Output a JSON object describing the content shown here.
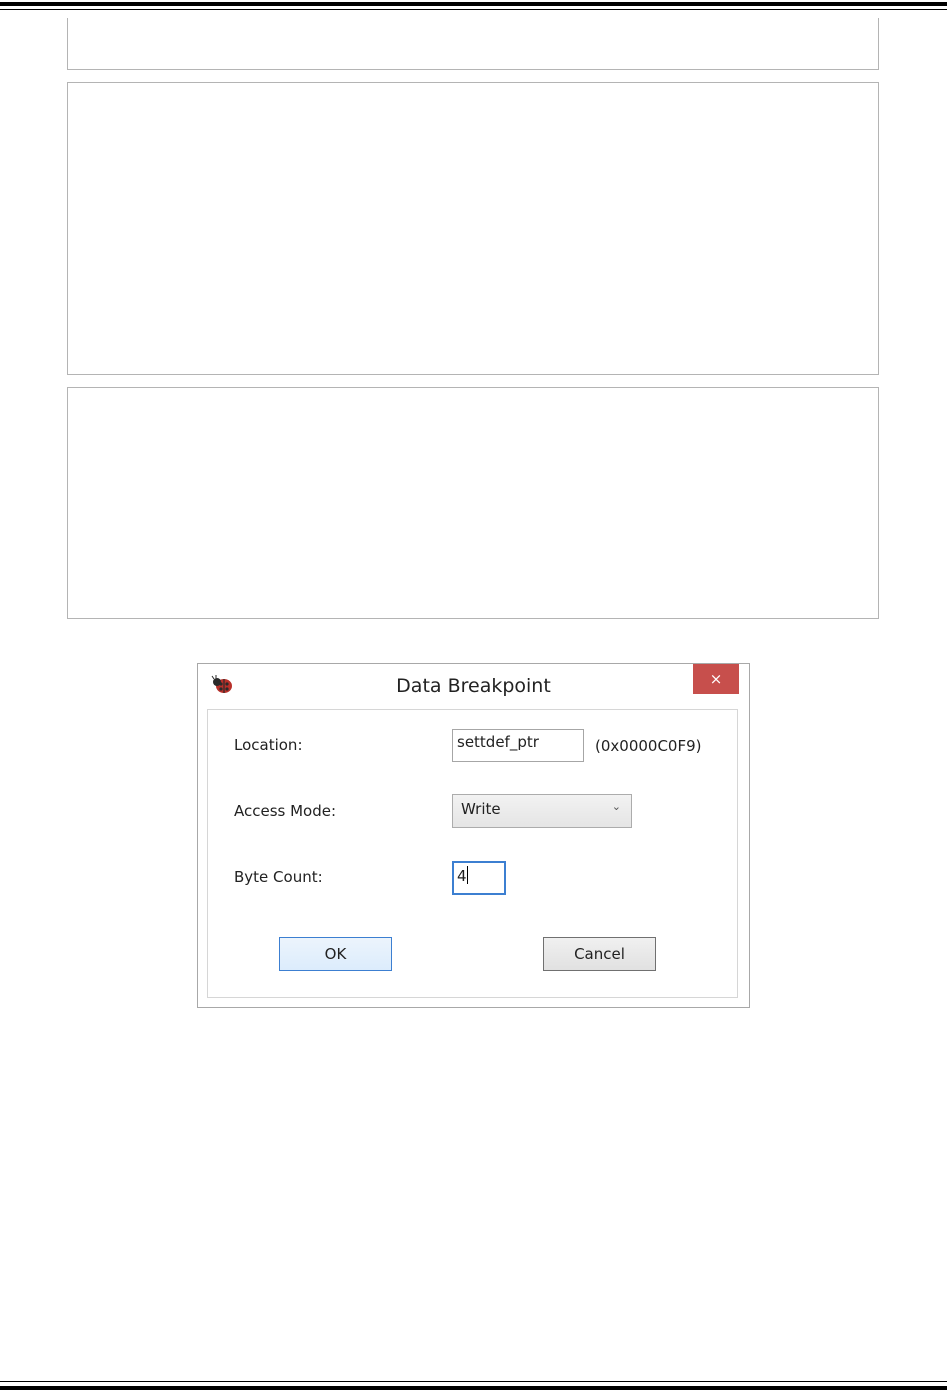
{
  "dialog": {
    "title": "Data Breakpoint",
    "close_symbol": "×",
    "icon": "ladybug-icon",
    "fields": {
      "location": {
        "label": "Location:",
        "value": "settdef_ptr",
        "address": "(0x0000C0F9)"
      },
      "access_mode": {
        "label": "Access Mode:",
        "value": "Write"
      },
      "byte_count": {
        "label": "Byte Count:",
        "value": "4"
      }
    },
    "buttons": {
      "ok": "OK",
      "cancel": "Cancel"
    },
    "colors": {
      "close_button": "#c74f4c",
      "focus": "#3c7fd1"
    }
  }
}
